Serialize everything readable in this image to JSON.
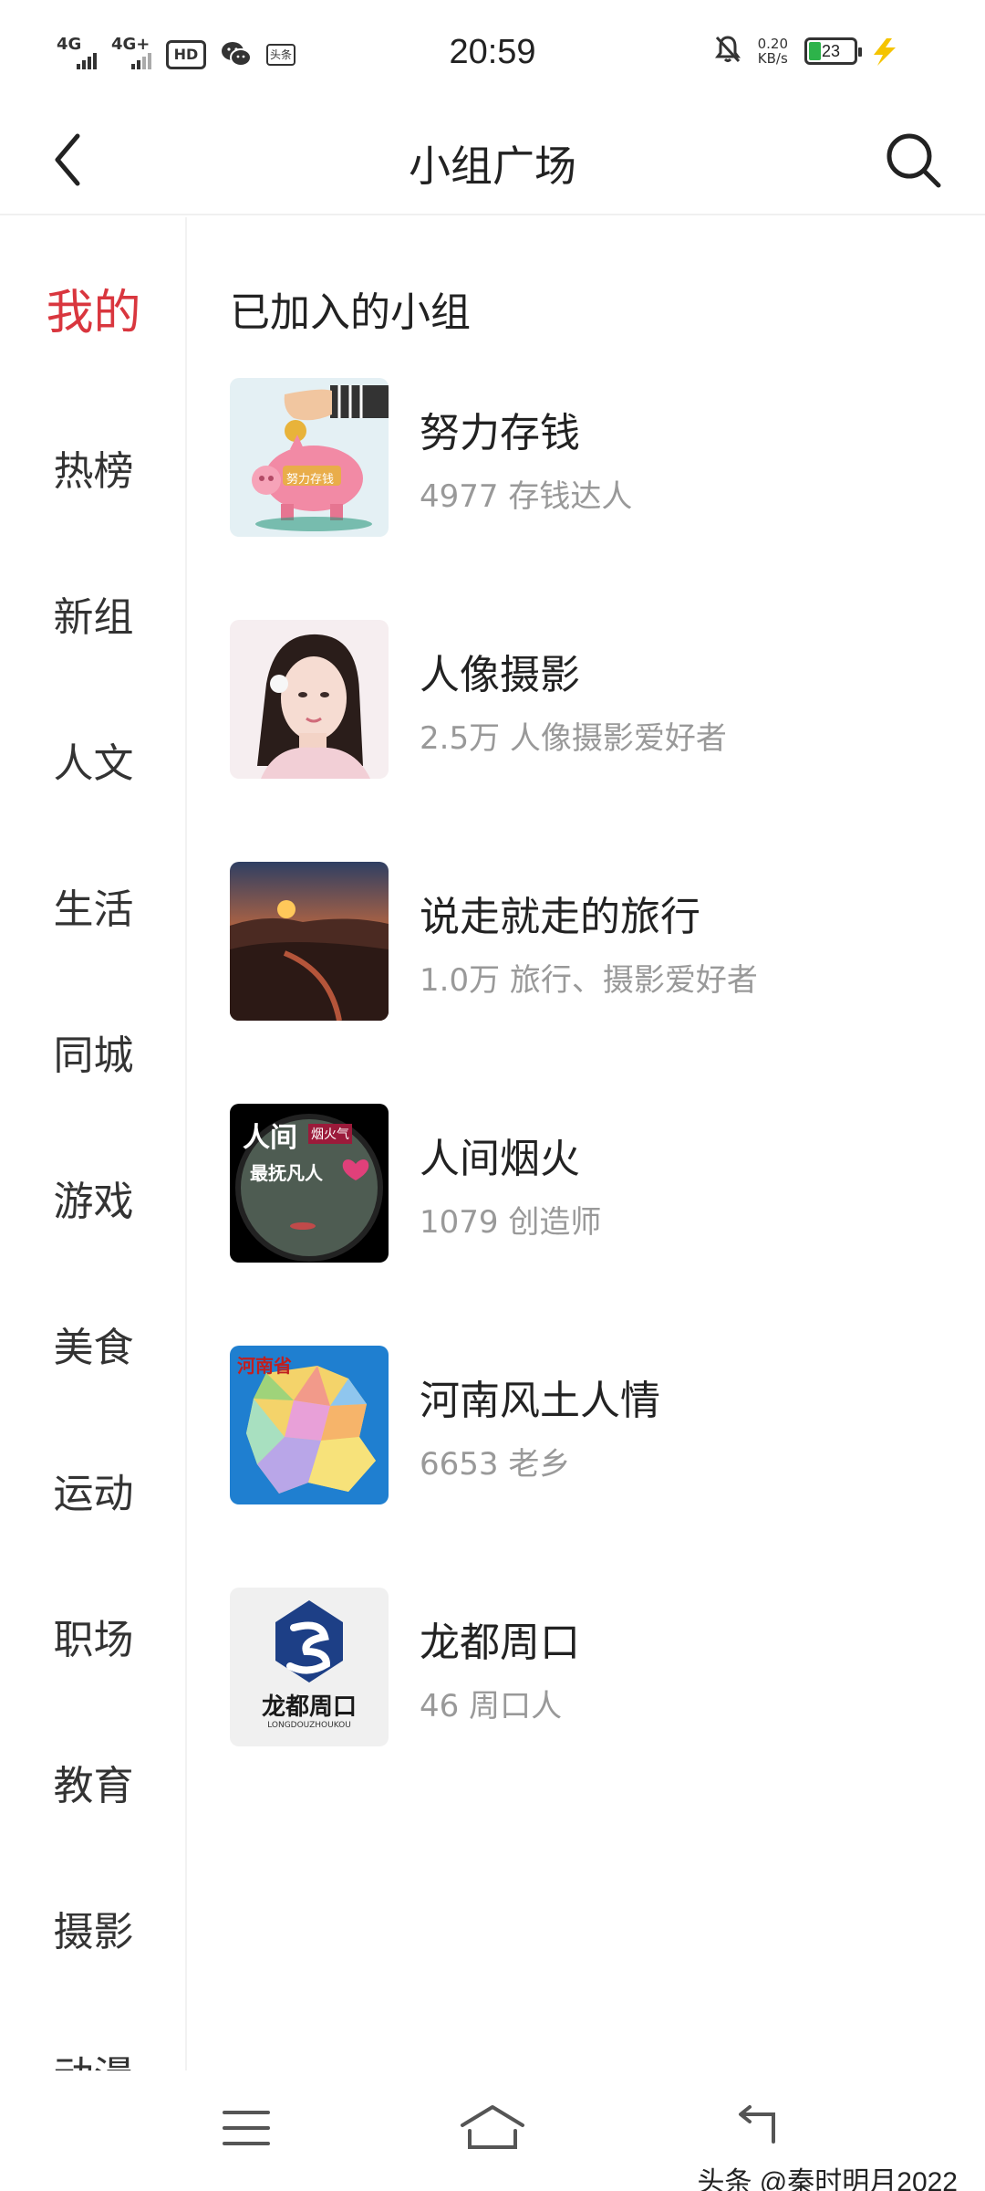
{
  "status_bar": {
    "net1": "4G",
    "net2": "4G+",
    "hd": "HD",
    "toutiao_small": "头条",
    "time": "20:59",
    "speed_value": "0.20",
    "speed_unit": "KB/s",
    "battery": "23",
    "battery_color": "#2db34a"
  },
  "header": {
    "title": "小组广场"
  },
  "sidebar": {
    "items": [
      {
        "label": "我的"
      },
      {
        "label": "热榜"
      },
      {
        "label": "新组"
      },
      {
        "label": "人文"
      },
      {
        "label": "生活"
      },
      {
        "label": "同城"
      },
      {
        "label": "游戏"
      },
      {
        "label": "美食"
      },
      {
        "label": "运动"
      },
      {
        "label": "职场"
      },
      {
        "label": "教育"
      },
      {
        "label": "摄影"
      },
      {
        "label": "动漫"
      }
    ]
  },
  "main": {
    "section_title": "已加入的小组",
    "groups": [
      {
        "name": "努力存钱",
        "desc": "4977 存钱达人",
        "thumb_text": "努力存钱"
      },
      {
        "name": "人像摄影",
        "desc": "2.5万 人像摄影爱好者"
      },
      {
        "name": "说走就走的旅行",
        "desc": "1.0万 旅行、摄影爱好者"
      },
      {
        "name": "人间烟火",
        "desc": "1079 创造师",
        "thumb_text_1": "人间",
        "thumb_text_2": "烟火气",
        "thumb_text_3": "最抚凡人"
      },
      {
        "name": "河南风土人情",
        "desc": "6653 老乡",
        "thumb_text": "河南省"
      },
      {
        "name": "龙都周口",
        "desc": "46 周口人",
        "thumb_text": "龙都周口",
        "thumb_subtext": "LONGDOUZHOUKOU"
      }
    ]
  },
  "watermark": "头条 @秦时明月2022",
  "colors": {
    "accent_red": "#d9363e",
    "muted_text": "#999999"
  }
}
